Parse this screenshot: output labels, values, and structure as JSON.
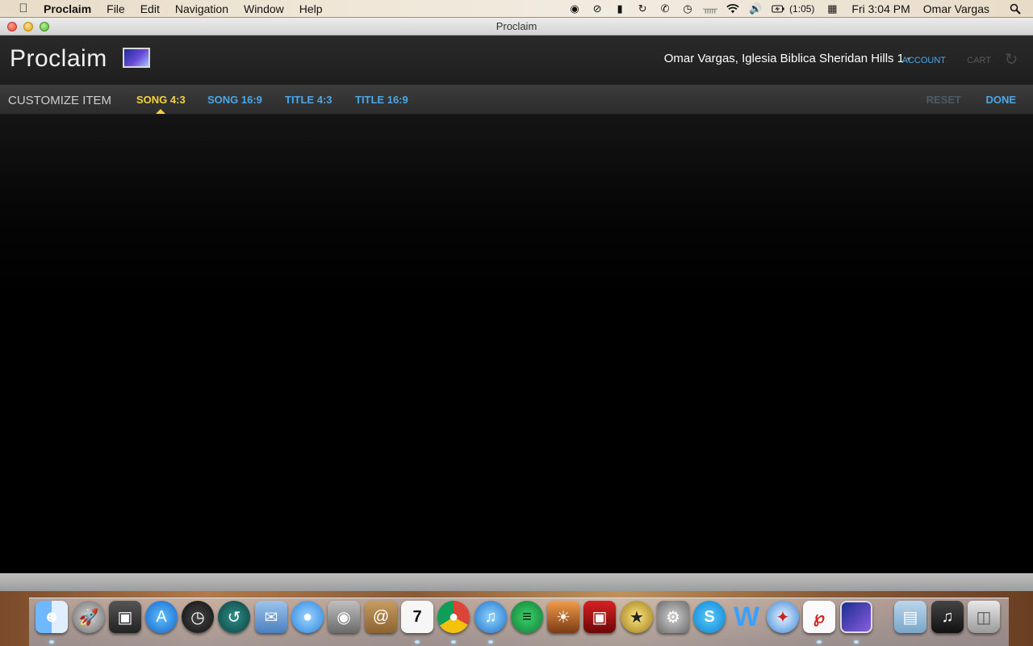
{
  "menubar": {
    "apple_glyph": "",
    "app_name": "Proclaim",
    "items": [
      "File",
      "Edit",
      "Navigation",
      "Window",
      "Help"
    ],
    "battery_text": "(1:05)",
    "clock": "Fri 3:04 PM",
    "user": "Omar Vargas",
    "status_icons": [
      "headphones-icon",
      "do-not-disturb-icon",
      "bookmark-icon",
      "sync-icon",
      "phone-icon",
      "time-machine-icon",
      "bluetooth-icon",
      "wifi-icon",
      "volume-icon",
      "battery-icon",
      "calendar-icon",
      "spotlight-search-icon"
    ]
  },
  "window": {
    "title": "Proclaim"
  },
  "header": {
    "logo_text": "Proclaim",
    "user_org": "Omar Vargas,  Iglesia Biblica Sheridan Hills 1",
    "account_label": "ACCOUNT",
    "cart_label": "CART"
  },
  "toolbar": {
    "title": "CUSTOMIZE ITEM",
    "tabs": [
      {
        "label": "SONG 4:3",
        "active": true
      },
      {
        "label": "SONG 16:9",
        "active": false
      },
      {
        "label": "TITLE 4:3",
        "active": false
      },
      {
        "label": "TITLE 16:9",
        "active": false
      }
    ],
    "reset_label": "RESET",
    "done_label": "DONE"
  },
  "colors": {
    "accent_blue": "#4aa8e8",
    "active_tab": "#f4d23c",
    "disabled": "#4c5a66"
  },
  "dock": {
    "apps": [
      "finder",
      "launchpad",
      "photo-booth",
      "app-store",
      "dashboard",
      "time-machine",
      "mail",
      "messages",
      "facetime",
      "contacts",
      "calendar",
      "chrome",
      "itunes",
      "spotify",
      "iphoto",
      "photo-booth-red",
      "imovie",
      "system-preferences",
      "skype",
      "word",
      "safari",
      "acrobat",
      "proclaim",
      "applications-folder",
      "music-stack",
      "trash"
    ],
    "calendar_day": "7"
  }
}
